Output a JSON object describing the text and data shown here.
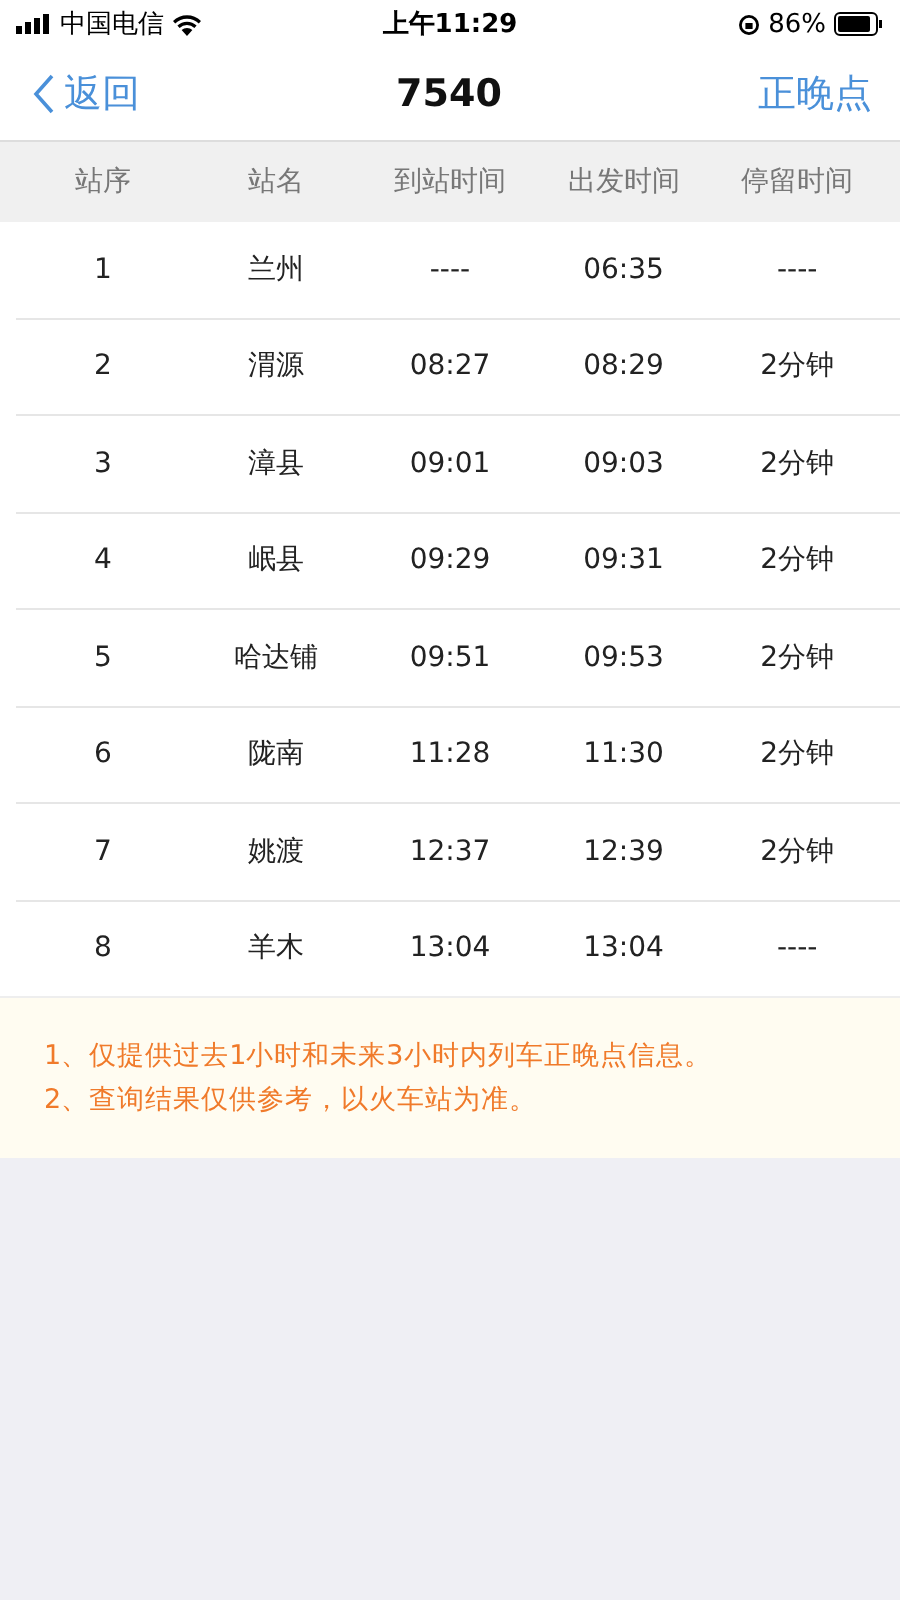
{
  "status_bar": {
    "carrier": "中国电信",
    "time": "上午11:29",
    "battery": "86%"
  },
  "nav": {
    "back": "返回",
    "title": "7540",
    "action": "正晚点"
  },
  "table": {
    "columns": [
      "站序",
      "站名",
      "到站时间",
      "出发时间",
      "停留时间"
    ],
    "rows": [
      [
        "1",
        "兰州",
        "----",
        "06:35",
        "----"
      ],
      [
        "2",
        "渭源",
        "08:27",
        "08:29",
        "2分钟"
      ],
      [
        "3",
        "漳县",
        "09:01",
        "09:03",
        "2分钟"
      ],
      [
        "4",
        "岷县",
        "09:29",
        "09:31",
        "2分钟"
      ],
      [
        "5",
        "哈达铺",
        "09:51",
        "09:53",
        "2分钟"
      ],
      [
        "6",
        "陇南",
        "11:28",
        "11:30",
        "2分钟"
      ],
      [
        "7",
        "姚渡",
        "12:37",
        "12:39",
        "2分钟"
      ],
      [
        "8",
        "羊木",
        "13:04",
        "13:04",
        "----"
      ]
    ]
  },
  "notes": [
    "1、仅提供过去1小时和未来3小时内列车正晚点信息。",
    "2、查询结果仅供参考，以火车站为准。"
  ]
}
